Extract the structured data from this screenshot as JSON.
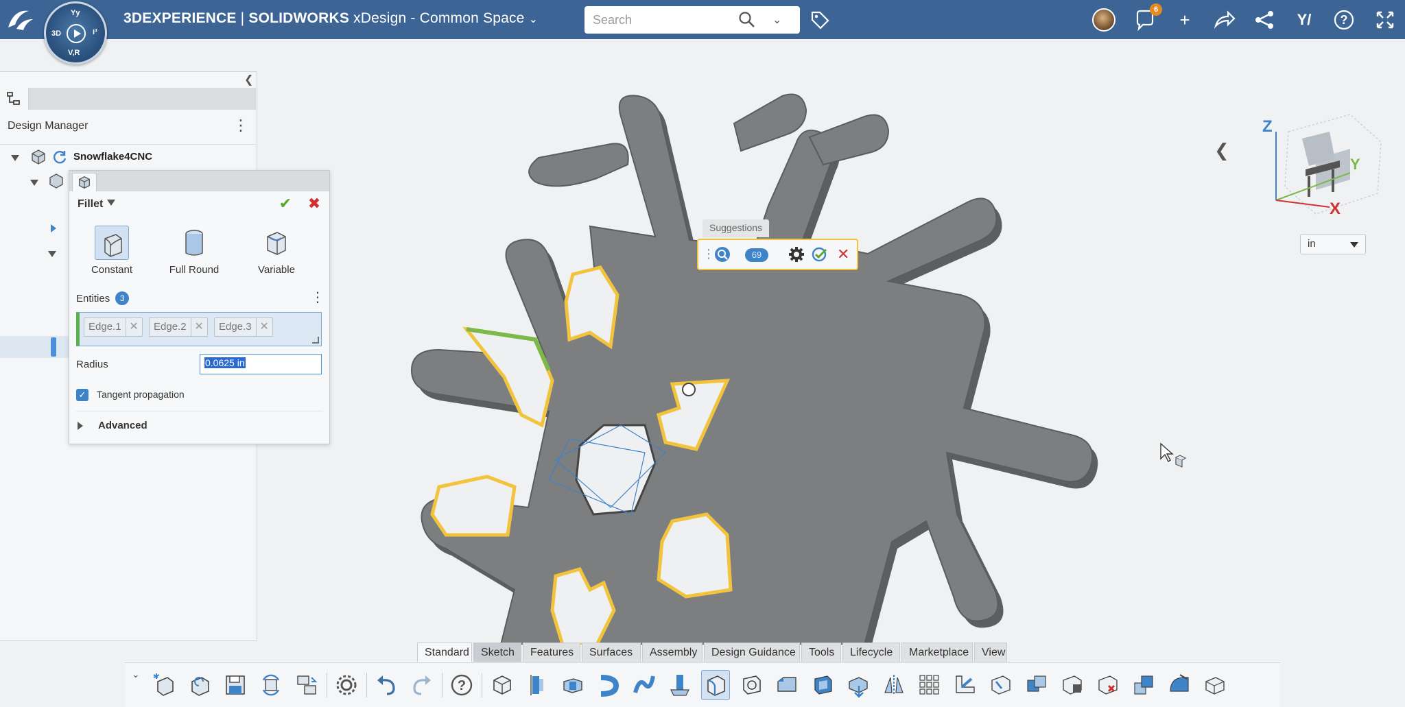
{
  "header": {
    "title_brand": "3DEXPERIENCE",
    "title_sep": " | ",
    "title_app": "SOLIDWORKS",
    "title_rest": " xDesign - Common Space",
    "search_placeholder": "Search",
    "notification_count": "6",
    "compass": {
      "top": "Yy",
      "left": "3D",
      "right": "i³",
      "bottom": "V,R"
    }
  },
  "design_manager": {
    "title": "Design Manager",
    "root_item": "Snowflake4CNC"
  },
  "fillet": {
    "title": "Fillet",
    "types": [
      {
        "label": "Constant",
        "active": true
      },
      {
        "label": "Full Round",
        "active": false
      },
      {
        "label": "Variable",
        "active": false
      }
    ],
    "entities_label": "Entities",
    "entities_count": "3",
    "edges": [
      "Edge.1",
      "Edge.2",
      "Edge.3"
    ],
    "radius_label": "Radius",
    "radius_value": "0.0625 in",
    "tangent_label": "Tangent propagation",
    "tangent_checked": true,
    "advanced_label": "Advanced"
  },
  "suggestions": {
    "title": "Suggestions",
    "count": "69"
  },
  "viewcube": {
    "z": "Z",
    "y": "Y",
    "x": "X"
  },
  "unit_select": {
    "value": "in"
  },
  "ribbon_tabs": [
    "Standard",
    "Sketch",
    "Features",
    "Surfaces",
    "Assembly",
    "Design Guidance",
    "Tools",
    "Lifecycle",
    "Marketplace",
    "View"
  ],
  "active_tab": "Standard",
  "colors": {
    "topbar": "#3c6596",
    "accent": "#3f83c9",
    "highlight": "#f2c43d",
    "confirm": "#5aa52b",
    "cancel": "#d03030",
    "model": "#7c7e80"
  }
}
